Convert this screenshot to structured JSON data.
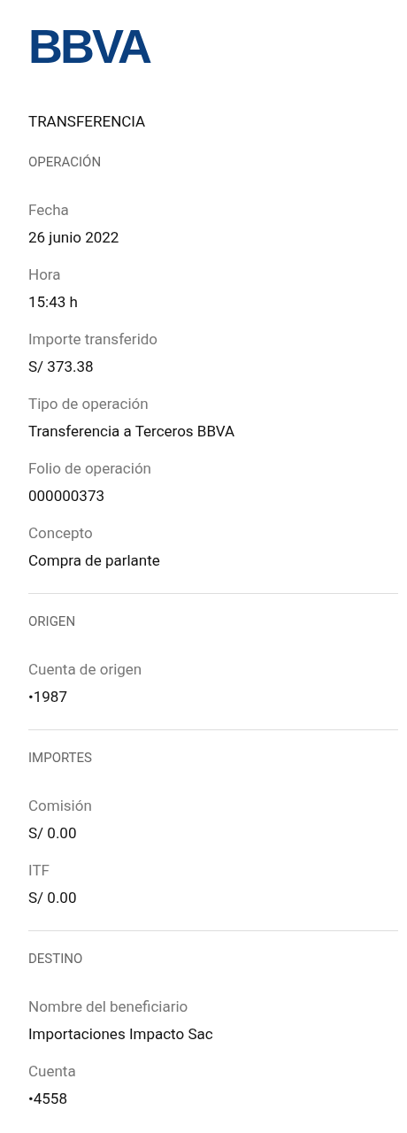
{
  "logo": {
    "text": "BBVA"
  },
  "title": "TRANSFERENCIA",
  "sections": [
    {
      "title": "OPERACIÓN",
      "fields": [
        {
          "label": "Fecha",
          "value": "26 junio 2022"
        },
        {
          "label": "Hora",
          "value": "15:43 h"
        },
        {
          "label": "Importe transferido",
          "value": "S/ 373.38"
        },
        {
          "label": "Tipo de operación",
          "value": "Transferencia a Terceros BBVA"
        },
        {
          "label": "Folio de operación",
          "value": "000000373"
        },
        {
          "label": "Concepto",
          "value": "Compra de parlante"
        }
      ]
    },
    {
      "title": "ORIGEN",
      "fields": [
        {
          "label": "Cuenta de origen",
          "value": "•1987"
        }
      ]
    },
    {
      "title": "IMPORTES",
      "fields": [
        {
          "label": "Comisión",
          "value": "S/ 0.00"
        },
        {
          "label": "ITF",
          "value": "S/ 0.00"
        }
      ]
    },
    {
      "title": "DESTINO",
      "fields": [
        {
          "label": "Nombre del beneficiario",
          "value": "Importaciones Impacto Sac"
        },
        {
          "label": "Cuenta",
          "value": "•4558"
        }
      ]
    }
  ]
}
